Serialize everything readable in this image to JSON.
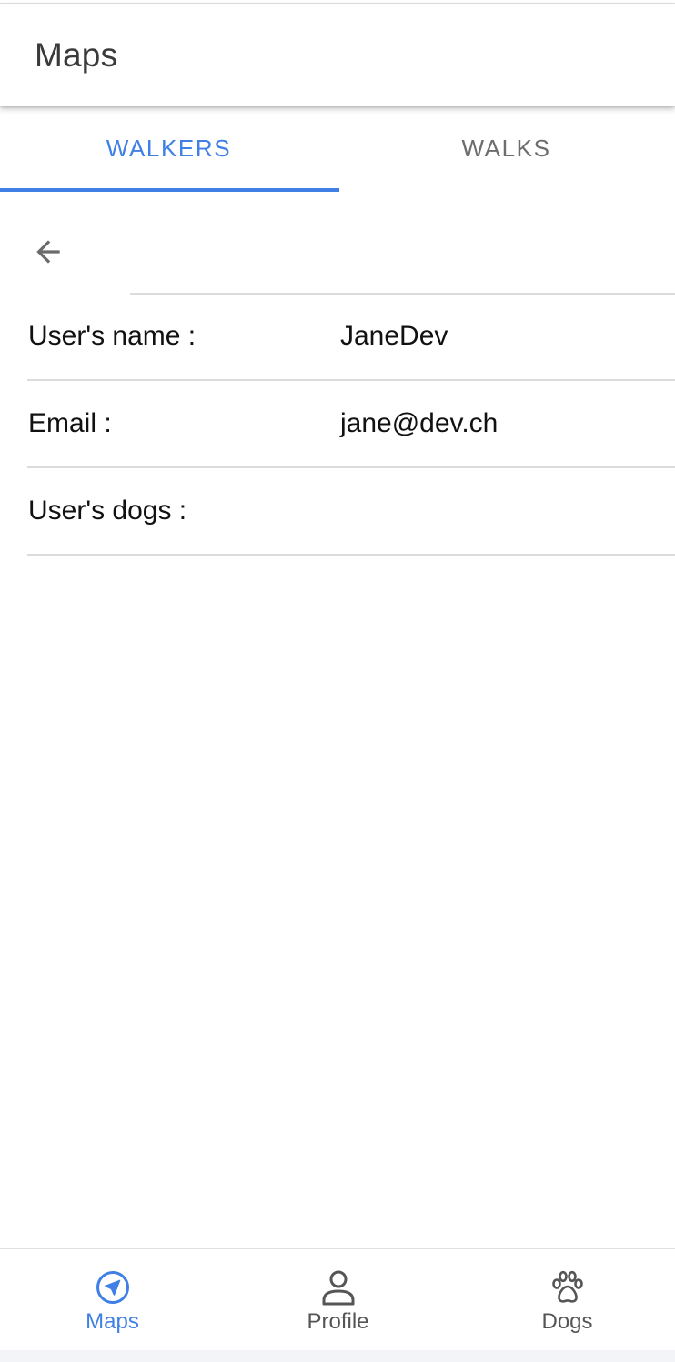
{
  "header": {
    "title": "Maps"
  },
  "tabs": [
    {
      "label": "WALKERS",
      "active": true
    },
    {
      "label": "WALKS",
      "active": false
    }
  ],
  "toolbar": {
    "back_icon": "arrow-left-icon"
  },
  "details": {
    "rows": [
      {
        "label": "User's name :",
        "value": "JaneDev"
      },
      {
        "label": "Email :",
        "value": "jane@dev.ch"
      },
      {
        "label": "User's dogs :",
        "value": ""
      }
    ]
  },
  "bottom_nav": {
    "items": [
      {
        "label": "Maps",
        "icon": "navigation-icon",
        "active": true
      },
      {
        "label": "Profile",
        "icon": "person-icon",
        "active": false
      },
      {
        "label": "Dogs",
        "icon": "paw-icon",
        "active": false
      }
    ]
  },
  "colors": {
    "accent": "#3f7fe6",
    "inactive_tab": "#6d6d6d",
    "divider": "#dcdcdc"
  }
}
